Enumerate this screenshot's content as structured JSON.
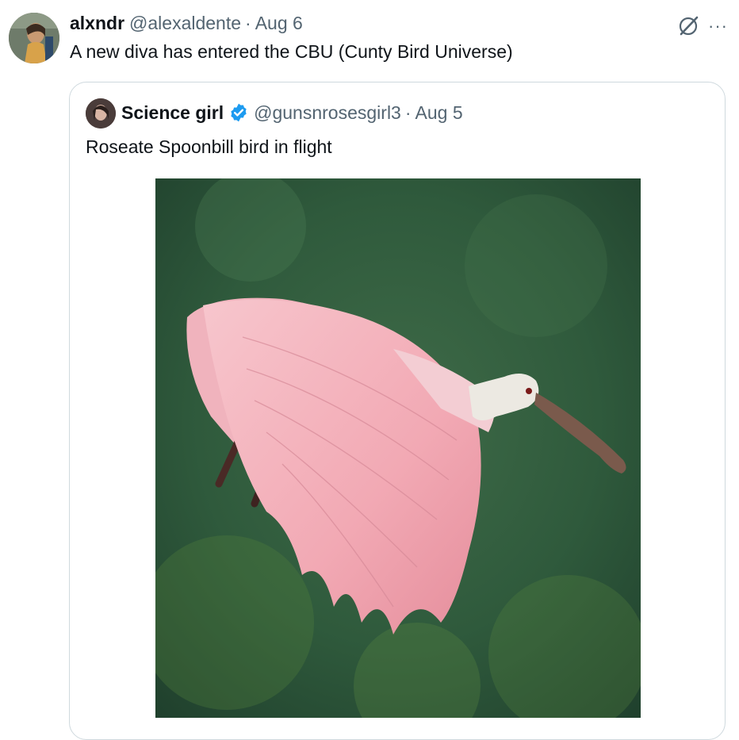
{
  "tweet": {
    "author_name": "alxndr",
    "author_handle": "@alexaldente",
    "separator": "·",
    "date": "Aug 6",
    "text": "A new diva has entered the CBU (Cunty Bird Universe)",
    "avatar_icon": "user-avatar",
    "actions": {
      "grok_icon": "grok-icon",
      "more_label": "···"
    }
  },
  "quoted_tweet": {
    "author_name": "Science girl",
    "verified_icon": "verified-badge-icon",
    "author_handle": "@gunsnrosesgirl3",
    "separator": "·",
    "date": "Aug 5",
    "text": "Roseate Spoonbill bird in flight",
    "media": "photo of a pink roseate spoonbill flying against a blurred green background"
  },
  "colors": {
    "text_primary": "#0f1419",
    "text_secondary": "#536471",
    "border": "#cfd9de",
    "verified_blue": "#1d9bf0",
    "bird_pink": "#f2a9b4",
    "background_green": "#2f5238"
  }
}
